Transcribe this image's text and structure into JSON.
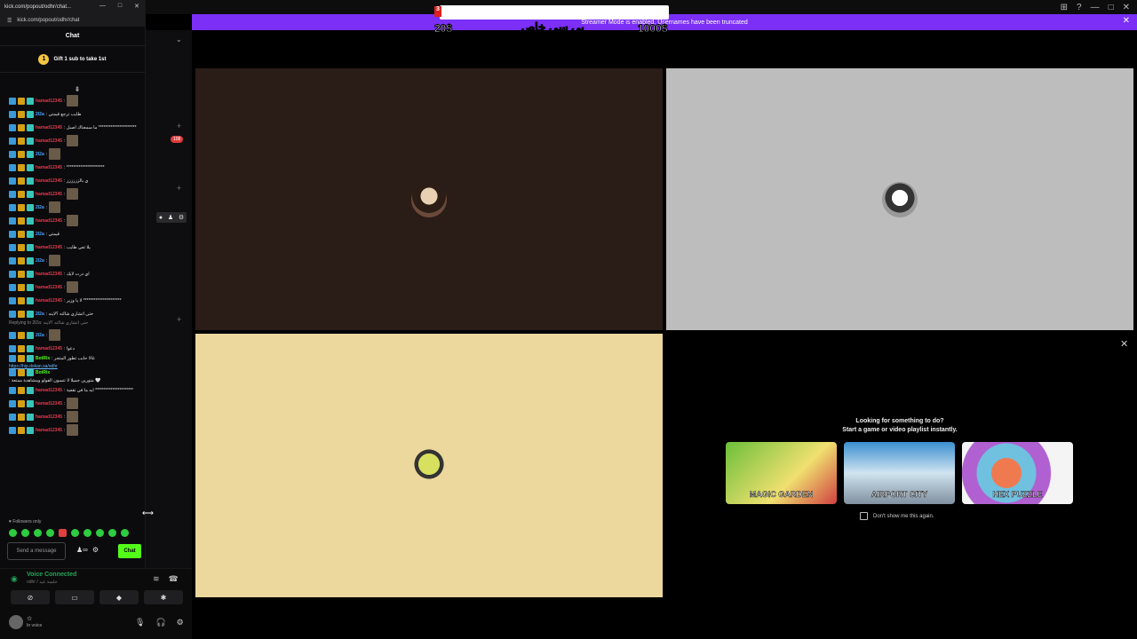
{
  "window": {
    "url": "kick.com/popout/odhr/chat",
    "url_short": "kick.com/popout/odhr/chat...",
    "top_icons": [
      "⊞",
      "?",
      "—",
      "□",
      "✕"
    ]
  },
  "banner": {
    "text": "Streamer Mode is enabled. Usernames have been truncated",
    "close": "✕",
    "red_tag": "3",
    "score_left": "20$",
    "score_right": "1000$",
    "arabic_title": "بي سي خاص فيني"
  },
  "chat": {
    "header": "Chat",
    "gift_badge": "1",
    "gift_text": "Gift 1 sub to take 1st",
    "scroll_glyph": "⇟",
    "messages": [
      {
        "user": "hamad12345",
        "color": "red",
        "text": ":",
        "emote": true
      },
      {
        "user": "2l2a",
        "color": "blue",
        "text": ": طايب ترجع قيمتي",
        "emote": false
      },
      {
        "user": "hamad12345",
        "color": "red",
        "text": ": ما سمعناك اصبل **********************",
        "emote": false
      },
      {
        "user": "hamad12345",
        "color": "red",
        "text": ":",
        "emote": true
      },
      {
        "user": "2l2a",
        "color": "blue",
        "text": ":",
        "emote": true
      },
      {
        "user": "hamad12345",
        "color": "red",
        "text": ": **********************",
        "emote": false
      },
      {
        "user": "hamad12345",
        "color": "red",
        "text": ": ي بالزززززز",
        "emote": false
      },
      {
        "user": "hamad12345",
        "color": "red",
        "text": ":",
        "emote": true
      },
      {
        "user": "2l2a",
        "color": "blue",
        "text": ":",
        "emote": true
      },
      {
        "user": "hamad12345",
        "color": "red",
        "text": ":",
        "emote": true
      },
      {
        "user": "2l2a",
        "color": "blue",
        "text": ": قيمتي",
        "emote": false
      },
      {
        "user": "hamad12345",
        "color": "red",
        "text": ": يلا تعي طايب",
        "emote": false
      },
      {
        "user": "2l2a",
        "color": "blue",
        "text": ":",
        "emote": true
      },
      {
        "user": "hamad12345",
        "color": "red",
        "text": ": اي درت لايك",
        "emote": false
      },
      {
        "user": "hamad12345",
        "color": "red",
        "text": ":",
        "emote": true
      },
      {
        "user": "hamad12345",
        "color": "red",
        "text": ": لا يا وزير **********************",
        "emote": false
      },
      {
        "user": "2l2a",
        "color": "blue",
        "text": ": حتى اتشاري شالته ؟لاينه",
        "emote": false
      }
    ],
    "reply_note": "Replying to 2l2a: حتى اتشاري شالته ؟لاينه",
    "messages2": [
      {
        "user": "2l2a",
        "color": "blue",
        "text": ":",
        "emote": true
      },
      {
        "user": "hamad12345",
        "color": "red",
        "text": ": دعوا",
        "emote": false
      },
      {
        "user": "BotRix",
        "color": "green",
        "text": ": غالا حابب تطور المتجر",
        "emote": false,
        "link": "https://hip.dokan.sa/odhr"
      },
      {
        "user": "BotRix",
        "color": "green",
        "text": ": متورين جميلا لا تنسون الفولو ومشاهدة ممتعة 🤍",
        "emote": false
      },
      {
        "user": "hamad12345",
        "color": "red",
        "text": ": ايه ما في تقعية **********************",
        "emote": false
      },
      {
        "user": "hamad12345",
        "color": "red",
        "text": ":",
        "emote": true
      },
      {
        "user": "hamad12345",
        "color": "red",
        "text": ":",
        "emote": true
      },
      {
        "user": "hamad12345",
        "color": "red",
        "text": ":",
        "emote": true
      }
    ],
    "followers_only": "♥ Followers only",
    "send_placeholder": "Send a message",
    "chat_button": "Chat",
    "resize_glyph": "⟷"
  },
  "sidebar": {
    "notif_count": "108",
    "chevron": "⌄",
    "plus": "+"
  },
  "voice": {
    "status": "Voice Connected",
    "channel": "odhr / جلسة عيد",
    "username": "☆",
    "user_status": "In voice"
  },
  "suggestions": {
    "title_line1": "Looking for something to do?",
    "title_line2": "Start a game or video playlist instantly.",
    "activities": [
      "MAGIC GARDEN",
      "AIRPORT CITY",
      "HEX PUZZLE"
    ],
    "dont_show": "Don't show me this again.",
    "close": "✕"
  }
}
